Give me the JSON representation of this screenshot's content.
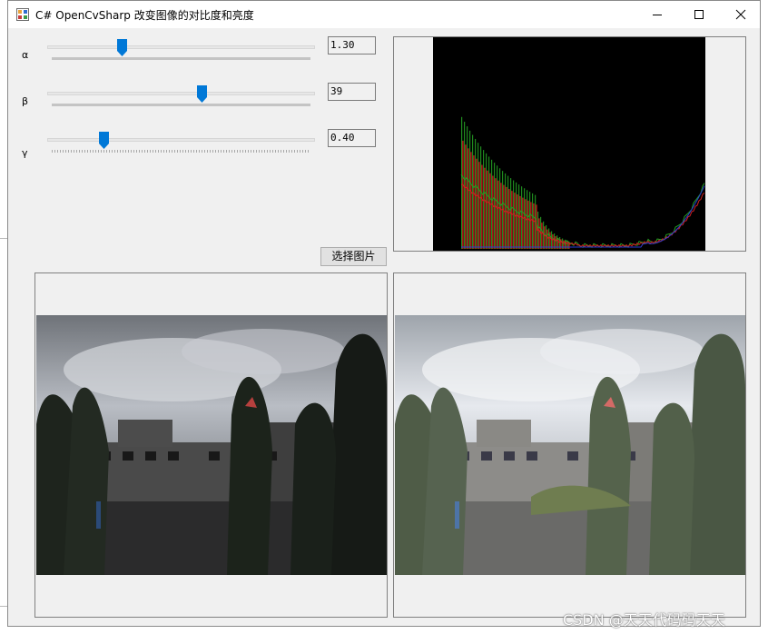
{
  "window": {
    "title": "C# OpenCvSharp 改变图像的对比度和亮度",
    "controls": {
      "minimize": "minimize-icon",
      "maximize": "maximize-icon",
      "close": "close-icon"
    }
  },
  "params": [
    {
      "label": "α",
      "value_text": "1.30",
      "slider_fraction": 0.27
    },
    {
      "label": "β",
      "value_text": "39",
      "slider_fraction": 0.58
    },
    {
      "label": "γ",
      "value_text": "0.40",
      "slider_fraction": 0.2
    }
  ],
  "select_button": "选择图片",
  "histogram_channels": [
    "blue",
    "green",
    "red"
  ],
  "images": {
    "original": "original-photo",
    "adjusted": "adjusted-photo"
  },
  "watermark": "CSDN @天天代码码天天",
  "colors": {
    "accent": "#0078d7",
    "titlebar": "#ffffff",
    "window": "#f0f0f0",
    "histogram_bg": "#000000"
  }
}
